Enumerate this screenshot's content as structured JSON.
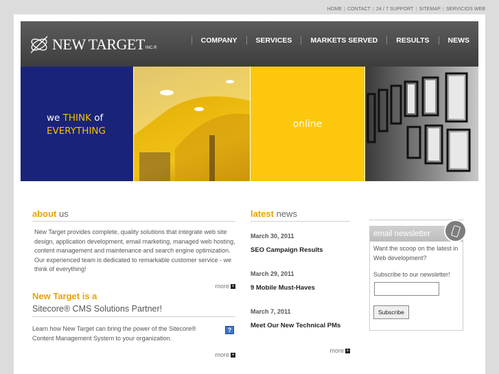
{
  "utility_nav": [
    "HOME",
    "CONTACT",
    "24 / 7 SUPPORT",
    "SITEMAP",
    "SERVICIOS WEB"
  ],
  "logo": {
    "name": "NEW TARGET",
    "suffix": "INC.®"
  },
  "main_nav": [
    "COMPANY",
    "SERVICES",
    "MARKETS SERVED",
    "RESULTS",
    "NEWS"
  ],
  "hero": {
    "panel1": {
      "we": "we",
      "think": "THINK",
      "of": "of",
      "everything": "EVERYTHING"
    },
    "panel3": {
      "text": "online"
    }
  },
  "about": {
    "title_accent": "about",
    "title_rest": "us",
    "body": "New Target provides complete, quality solutions that integrate web site design, application development, email marketing, managed web hosting, content management and maintenance and search engine optimization. Our experienced team is dedicated to remarkable customer service - we think of everything!",
    "more": "more"
  },
  "partner": {
    "line1": "New Target is a",
    "line2": "Sitecore® CMS Solutions Partner!",
    "body": "Learn how New Target can bring the power of the Sitecore® Content Management System to your organization.",
    "help": "?",
    "more": "more"
  },
  "news": {
    "title_accent": "latest",
    "title_rest": "news",
    "items": [
      {
        "date": "March 30, 2011",
        "title": "SEO Campaign Results"
      },
      {
        "date": "March 29, 2011",
        "title": "9 Mobile Must-Haves"
      },
      {
        "date": "March 7, 2011",
        "title": "Meet Our New Technical PMs"
      }
    ],
    "more": "more"
  },
  "newsletter": {
    "header": "email newsletter",
    "text": "Want the scoop on the latest in Web development?",
    "subscribe_prompt": "Subscribe to our newsletter!",
    "input_value": "",
    "button": "Subscribe"
  },
  "colors": {
    "accent": "#e8a200",
    "navy": "#1a237a",
    "yellow": "#fcc70d",
    "header": "#4a4a4a"
  }
}
